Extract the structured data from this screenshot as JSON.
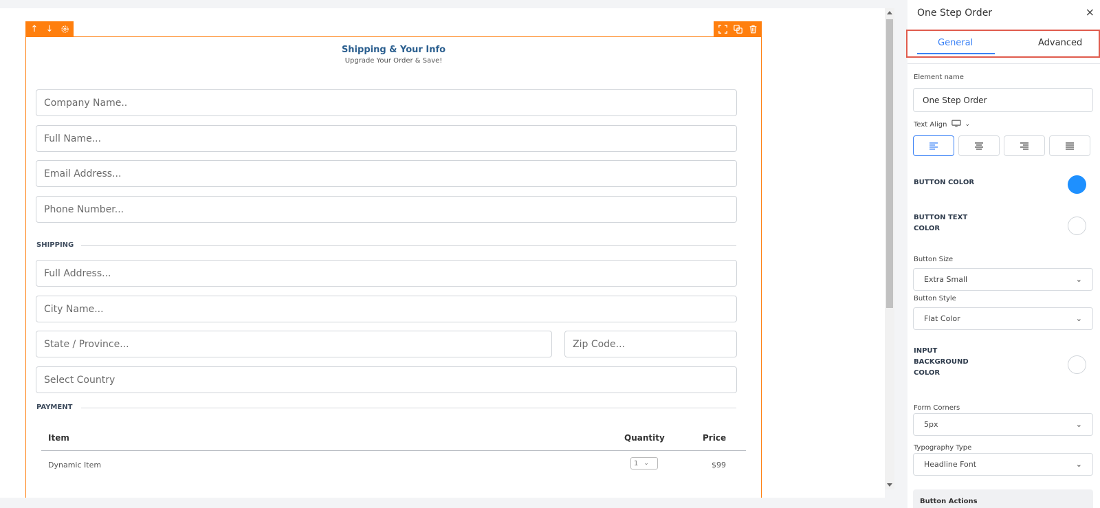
{
  "toolbar": {
    "left_icons": [
      "arrow-up-icon",
      "arrow-down-icon",
      "gear-icon"
    ],
    "right_icons": [
      "expand-icon",
      "duplicate-icon",
      "trash-icon"
    ],
    "accent": "#ff7f0e"
  },
  "form": {
    "title": "Shipping & Your Info",
    "subtitle": "Upgrade Your Order & Save!",
    "fields": {
      "company": "Company Name..",
      "full_name": "Full Name...",
      "email": "Email Address...",
      "phone": "Phone Number...",
      "address": "Full Address...",
      "city": "City Name...",
      "state": "State / Province...",
      "zip": "Zip Code...",
      "country": "Select Country"
    },
    "sections": {
      "shipping": "SHIPPING",
      "payment": "PAYMENT"
    },
    "table": {
      "headers": {
        "item": "Item",
        "quantity": "Quantity",
        "price": "Price"
      },
      "row": {
        "item": "Dynamic Item",
        "qty": "1",
        "price": "$99"
      }
    }
  },
  "panel": {
    "title": "One Step Order",
    "close": "×",
    "tabs": {
      "general": "General",
      "advanced": "Advanced"
    },
    "element_name_label": "Element name",
    "element_name_value": "One Step Order",
    "text_align_label": "Text Align",
    "button_color_label": "BUTTON COLOR",
    "button_color": "#1e90ff",
    "button_text_color_label": [
      "BUTTON TEXT",
      "COLOR"
    ],
    "button_size_label": "Button Size",
    "button_size_value": "Extra Small",
    "button_style_label": "Button Style",
    "button_style_value": "Flat Color",
    "input_bg_label": [
      "INPUT",
      "BACKGROUND",
      "COLOR"
    ],
    "form_corners_label": "Form Corners",
    "form_corners_value": "5px",
    "typography_label": "Typography Type",
    "typography_value": "Headline Font",
    "button_actions_label": "Button Actions"
  }
}
